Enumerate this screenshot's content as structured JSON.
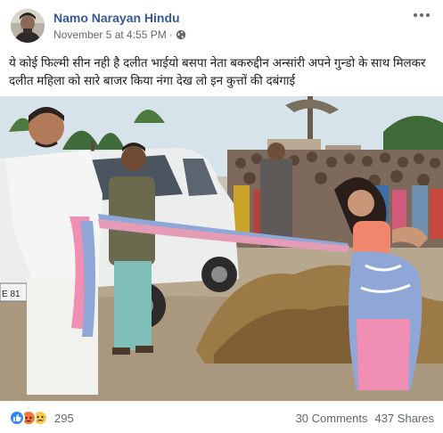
{
  "post": {
    "author": "Namo Narayan Hindu",
    "timestamp": "November 5 at 4:55 PM",
    "separator": "·",
    "privacy_icon": "globe-icon",
    "menu_icon": "more-options-icon",
    "text": "ये कोई फिल्मी सीन नही है दलीत भाईयो बसपा नेता बकरुद्दीन अन्सांरी अपने गुन्डो के साथ मिलकर दलीत महिला को सारे बाजर किया नंगा देख लो इन कुत्तों की दबंगाई",
    "photo": {
      "license_plate_text": "E 81"
    }
  },
  "footer": {
    "reaction_icons": [
      "like-icon",
      "angry-icon",
      "sad-icon"
    ],
    "reaction_count": "295",
    "comments": "30 Comments",
    "shares": "437 Shares"
  },
  "colors": {
    "author": "#365899",
    "meta": "#616770",
    "like": "#2d88ff",
    "angry": "#f2783c",
    "sad": "#f7c94b",
    "saree_pink": "#f08fb3",
    "saree_blue": "#8fa7d6"
  }
}
